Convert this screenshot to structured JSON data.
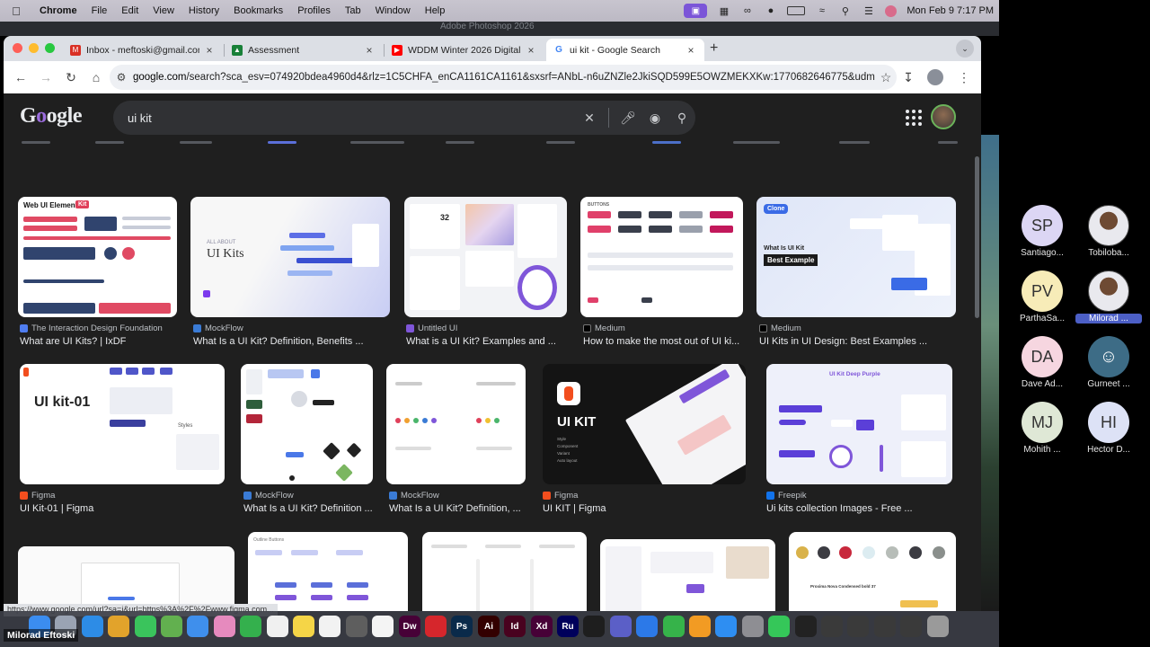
{
  "menubar": {
    "apple_icon": "apple-icon",
    "items": [
      "Chrome",
      "File",
      "Edit",
      "View",
      "History",
      "Bookmarks",
      "Profiles",
      "Tab",
      "Window",
      "Help"
    ],
    "clock": "Mon Feb 9  7:17 PM"
  },
  "desktop_title": "Adobe Photoshop 2026",
  "tabs": [
    {
      "label": "Inbox - meftoski@gmail.com",
      "icon": "gmail-icon",
      "color": "#d93025"
    },
    {
      "label": "Assessment",
      "icon": "drive-icon",
      "color": "#188038"
    },
    {
      "label": "WDDM Winter 2026 Digital D",
      "icon": "youtube-icon",
      "color": "#ff0000"
    },
    {
      "label": "ui kit - Google Search",
      "icon": "google-icon",
      "color": "#4285f4"
    }
  ],
  "address": {
    "domain": "google.com",
    "path": "/search?sca_esv=074920bdea4960d4&rlz=1C5CHFA_enCA1161CA1161&sxsrf=ANbL-n6uZNZle2JkiSQD599E5OWZMEKXKw:1770682646775&udm=2..."
  },
  "google": {
    "logo": "Google",
    "query": "ui kit"
  },
  "results": [
    {
      "source": "The Interaction Design Foundation",
      "caption": "What are UI Kits? | IxDF",
      "fav": "#4f7df0",
      "thumb_text": "Web UI Elements",
      "thumb_badge": "Kit"
    },
    {
      "source": "MockFlow",
      "caption": "What Is a UI Kit? Definition, Benefits ...",
      "fav": "#3a7bd5",
      "thumb_text": "UI Kits",
      "thumb_small": "ALL ABOUT"
    },
    {
      "source": "Untitled UI",
      "caption": "What is a UI Kit? Examples and ...",
      "fav": "#7f56d9",
      "thumb_num": "32"
    },
    {
      "source": "Medium",
      "caption": "How to make the most out of UI ki...",
      "fav": "#000000",
      "thumb_text": "BUTTONS"
    },
    {
      "source": "Medium",
      "caption": "UI Kits in UI Design: Best Examples ...",
      "fav": "#000000",
      "thumb_text": "What Is UI Kit",
      "thumb_badge": "Best Example",
      "thumb_tag": "Clone"
    },
    {
      "source": "Figma",
      "caption": "UI Kit-01 | Figma",
      "fav": "#f24e1e",
      "thumb_text": "UI kit-01",
      "thumb_small": "Styles"
    },
    {
      "source": "MockFlow",
      "caption": "What Is a UI Kit? Definition ...",
      "fav": "#3a7bd5"
    },
    {
      "source": "MockFlow",
      "caption": "What Is a UI Kit? Definition, ...",
      "fav": "#3a7bd5"
    },
    {
      "source": "Figma",
      "caption": "UI KIT | Figma",
      "fav": "#f24e1e",
      "thumb_text": "UI KIT",
      "thumb_list": [
        "Style",
        "Component",
        "Variant",
        "Auto layout"
      ]
    },
    {
      "source": "Freepik",
      "caption": "Ui kits collection Images - Free ...",
      "fav": "#1273eb",
      "thumb_text": "UI Kit Deep Purple"
    },
    {
      "thumb_text": ""
    },
    {
      "thumb_text": "Outline Buttons"
    },
    {
      "thumb_text": ""
    },
    {
      "thumb_text": ""
    },
    {
      "thumb_text": "Proxima Nova Condensed bold 37"
    }
  ],
  "status_url": "https://www.google.com/url?sa=i&url=https%3A%2F%2Fwww.figma.com...",
  "self_name": "Milorad Eftoski",
  "participants": [
    {
      "initials": "SP",
      "name": "Santiago...",
      "bg": "#dcd6f4"
    },
    {
      "initials": "",
      "name": "Tobiloba...",
      "bg": "photo"
    },
    {
      "initials": "PV",
      "name": "ParthaSa...",
      "bg": "#f7ecb8"
    },
    {
      "initials": "",
      "name": "Milorad ...",
      "bg": "photo",
      "highlight": true
    },
    {
      "initials": "DA",
      "name": "Dave Ad...",
      "bg": "#f6d6e0"
    },
    {
      "initials": "",
      "name": "Gurneet ...",
      "bg": "#3d6c86"
    },
    {
      "initials": "MJ",
      "name": "Mohith ...",
      "bg": "#dfe8d6"
    },
    {
      "initials": "HI",
      "name": "Hector D...",
      "bg": "#dde2f6"
    }
  ],
  "dock_apps": [
    {
      "name": "finder-icon",
      "label": "",
      "color": "#3b8df0"
    },
    {
      "name": "launchpad-icon",
      "label": "",
      "color": "#9aa3b3"
    },
    {
      "name": "safari-icon",
      "label": "",
      "color": "#2d8ce6"
    },
    {
      "name": "chrome-icon",
      "label": "",
      "color": "#e2a32b"
    },
    {
      "name": "messages-icon",
      "label": "",
      "color": "#3ac45c"
    },
    {
      "name": "maps-icon",
      "label": "",
      "color": "#62b04f"
    },
    {
      "name": "mail-icon",
      "label": "",
      "color": "#3f8fec"
    },
    {
      "name": "photos-icon",
      "label": "",
      "color": "#e68abe"
    },
    {
      "name": "facetime-icon",
      "label": "",
      "color": "#34b04d"
    },
    {
      "name": "reminders-icon",
      "label": "",
      "color": "#f0f0f0"
    },
    {
      "name": "notes-icon",
      "label": "",
      "color": "#f5d547"
    },
    {
      "name": "pages-icon",
      "label": "",
      "color": "#f2f2f2"
    },
    {
      "name": "calculator-icon",
      "label": "",
      "color": "#5e5e5e"
    },
    {
      "name": "freeform-icon",
      "label": "",
      "color": "#f4f4f4"
    },
    {
      "name": "dreamweaver-icon",
      "label": "Dw",
      "color": "#470137"
    },
    {
      "name": "acrobat-icon",
      "label": "",
      "color": "#d6262c"
    },
    {
      "name": "photoshop-icon",
      "label": "Ps",
      "color": "#0a2a4a"
    },
    {
      "name": "illustrator-icon",
      "label": "Ai",
      "color": "#330000"
    },
    {
      "name": "indesign-icon",
      "label": "Id",
      "color": "#49021f"
    },
    {
      "name": "xd-icon",
      "label": "Xd",
      "color": "#470137"
    },
    {
      "name": "rush-icon",
      "label": "Ru",
      "color": "#00005b"
    },
    {
      "name": "figma-icon",
      "label": "",
      "color": "#1e1e1e"
    },
    {
      "name": "teams-icon",
      "label": "",
      "color": "#5b5fc7"
    },
    {
      "name": "keynote-icon",
      "label": "",
      "color": "#2c79e8"
    },
    {
      "name": "numbers-icon",
      "label": "",
      "color": "#36b34a"
    },
    {
      "name": "pages-doc-icon",
      "label": "",
      "color": "#f29b23"
    },
    {
      "name": "appstore-icon",
      "label": "",
      "color": "#2e8ef2"
    },
    {
      "name": "settings-icon",
      "label": "",
      "color": "#8e8e93"
    },
    {
      "name": "phone-icon",
      "label": "",
      "color": "#35c759"
    },
    {
      "name": "cursor-app-icon",
      "label": "",
      "color": "#222222"
    },
    {
      "name": "window-icon",
      "label": "",
      "color": "#3a3a3a"
    },
    {
      "name": "window-icon",
      "label": "",
      "color": "#3a3a3a"
    },
    {
      "name": "window-icon",
      "label": "",
      "color": "#3a3a3a"
    },
    {
      "name": "window-icon",
      "label": "",
      "color": "#3a3a3a"
    },
    {
      "name": "trash-icon",
      "label": "",
      "color": "#9a9a9a"
    }
  ]
}
